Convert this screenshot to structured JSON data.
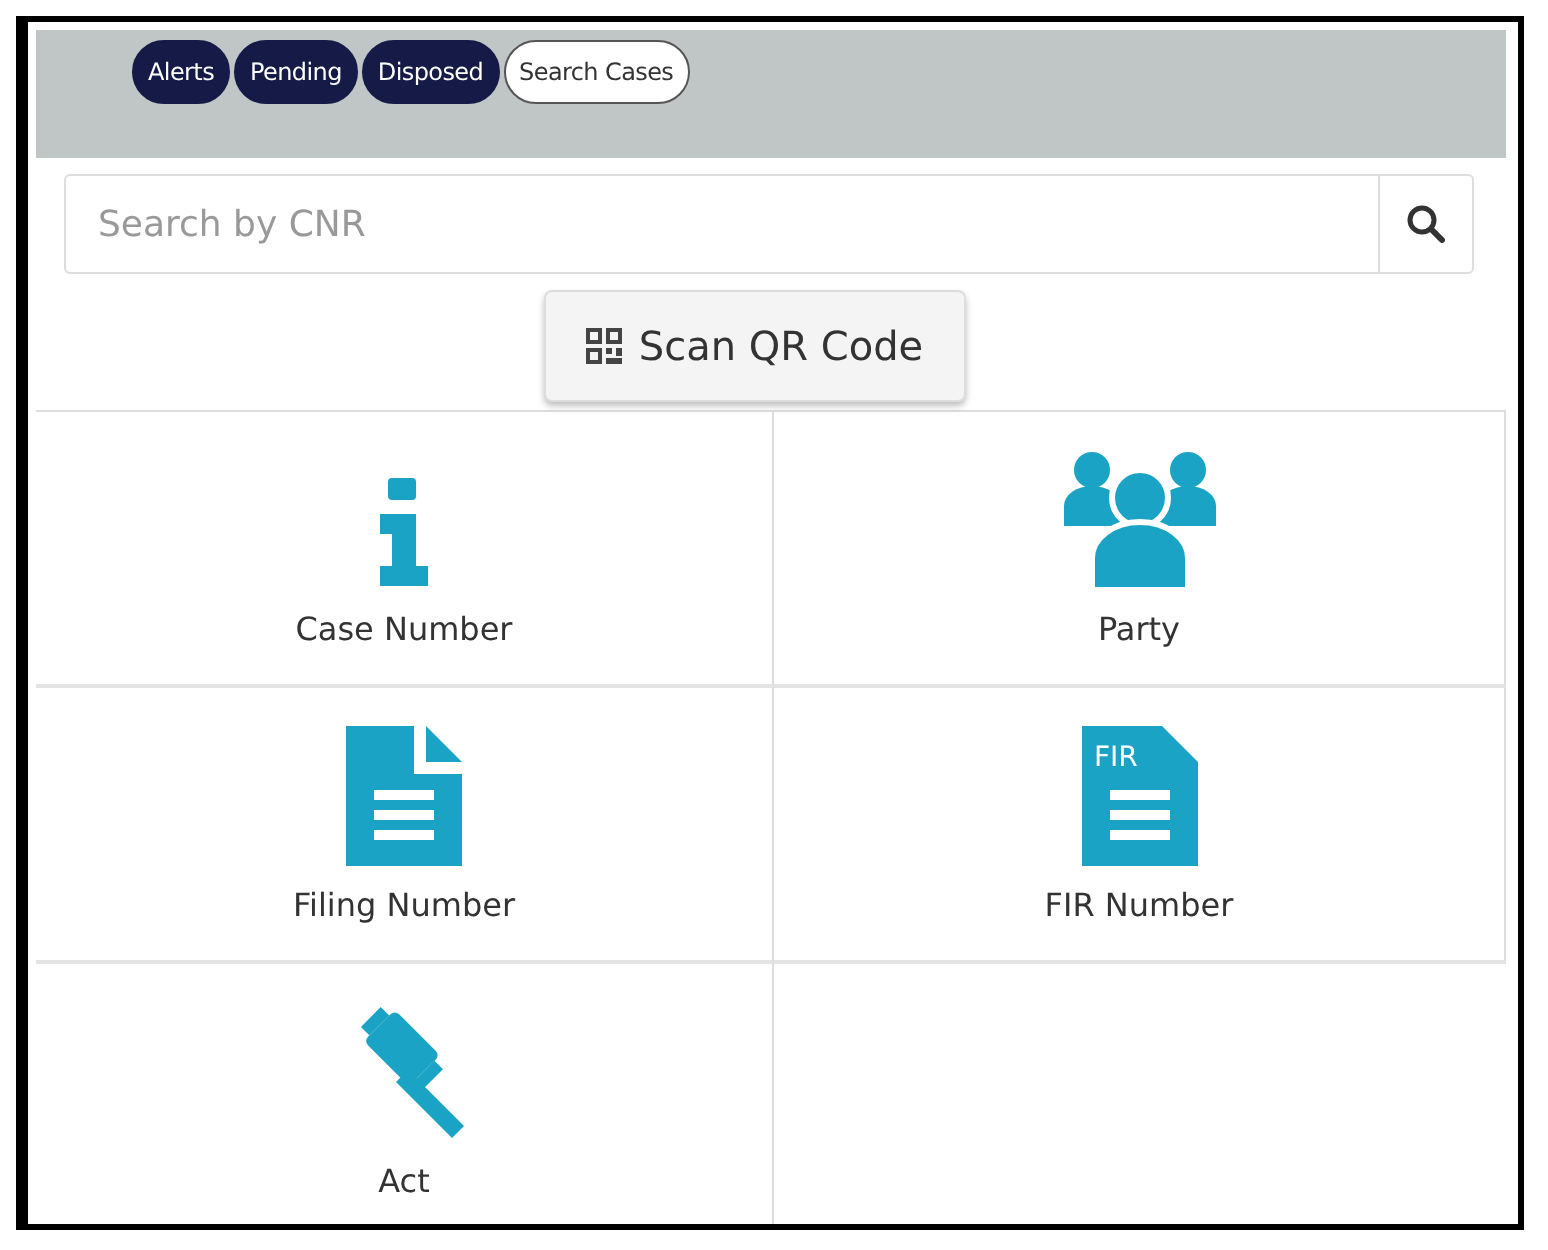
{
  "tabs": [
    {
      "label": "Alerts",
      "selected": false
    },
    {
      "label": "Pending",
      "selected": false
    },
    {
      "label": "Disposed",
      "selected": false
    },
    {
      "label": "Search Cases",
      "selected": true
    }
  ],
  "search": {
    "placeholder": "Search by CNR"
  },
  "scan_button": {
    "label": "Scan QR Code"
  },
  "options": [
    {
      "kind": "info",
      "label": "Case Number"
    },
    {
      "kind": "people",
      "label": "Party"
    },
    {
      "kind": "document",
      "label": "Filing Number"
    },
    {
      "kind": "fir",
      "label": "FIR Number"
    },
    {
      "kind": "gavel",
      "label": "Act"
    }
  ],
  "fir_icon_text": "FIR"
}
